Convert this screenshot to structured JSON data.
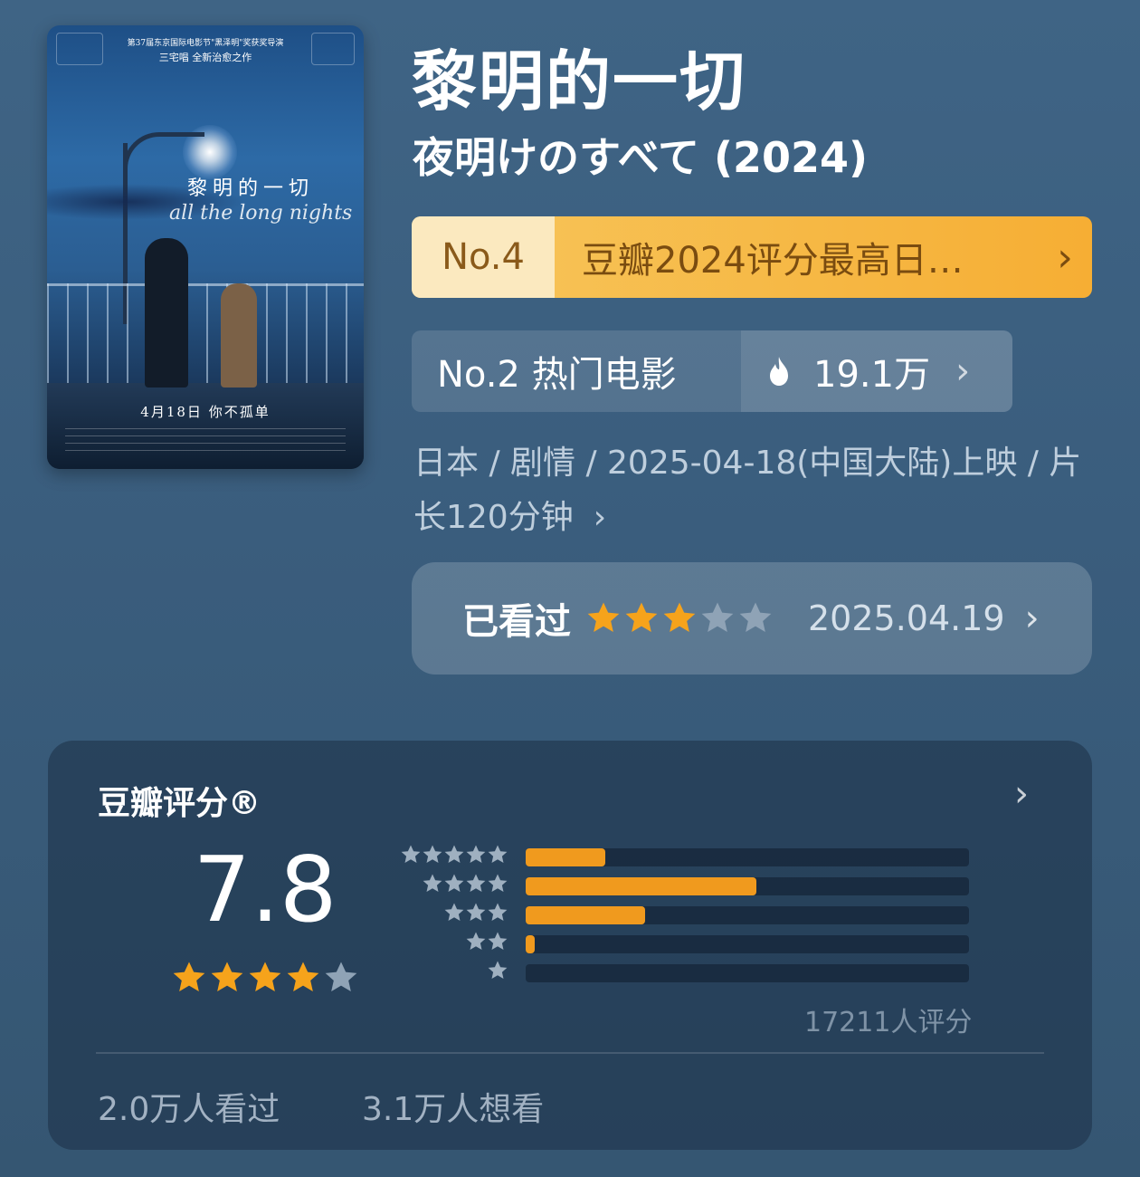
{
  "movie": {
    "title": "黎明的一切",
    "original_title": "夜明けのすべて  (2024)"
  },
  "poster": {
    "top_line1": "第37届东京国际电影节\"黑泽明\"奖获奖导演",
    "top_line2": "三宅唱 全新治愈之作",
    "title": "黎明的一切",
    "english": "all the long nights",
    "release": "4月18日  你不孤单"
  },
  "rank_banner": {
    "rank": "No.4",
    "text": "豆瓣2024评分最高日…",
    "chevron": "›"
  },
  "hot": {
    "rank_text": "No.2  热门电影",
    "count": "19.1万",
    "icon": "flame-icon",
    "chevron": "›"
  },
  "meta": {
    "text": "日本  /  剧情  /  2025-04-18(中国大陆)上映  /  片长120分钟",
    "chevron": "›"
  },
  "watched": {
    "label": "已看过",
    "my_rating": 3,
    "max_rating": 5,
    "date": "2025.04.19",
    "chevron": "›"
  },
  "rating": {
    "title": "豆瓣评分®",
    "score": "7.8",
    "stars": 4,
    "max_stars": 5,
    "distribution": [
      {
        "stars": 5,
        "fraction": 0.18
      },
      {
        "stars": 4,
        "fraction": 0.52
      },
      {
        "stars": 3,
        "fraction": 0.27
      },
      {
        "stars": 2,
        "fraction": 0.02
      },
      {
        "stars": 1,
        "fraction": 0.0
      }
    ],
    "count": "17211人评分",
    "watched_count": "2.0万人看过",
    "want_count": "3.1万人想看",
    "chevron": "›"
  },
  "colors": {
    "star_on": "#f6a31b",
    "star_off": "#8fa3b6",
    "bar_fill": "#f09a1e",
    "dist_star": "#9fb0c0"
  }
}
